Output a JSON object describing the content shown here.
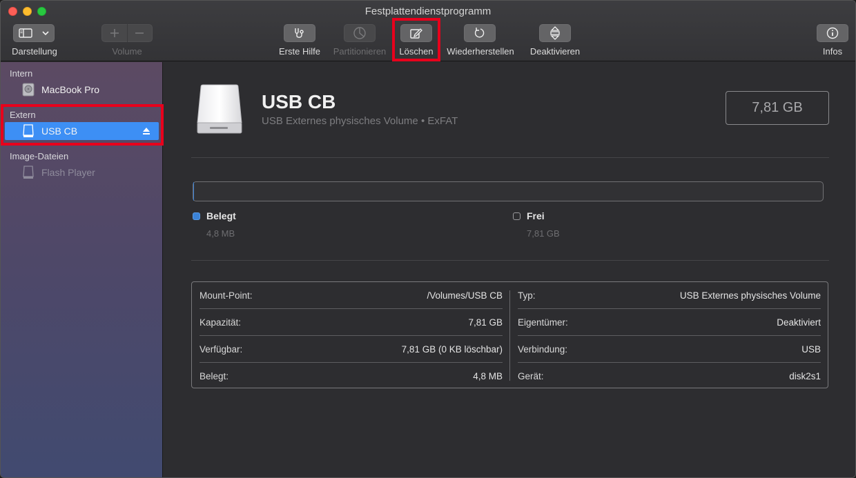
{
  "window": {
    "title": "Festplattendienstprogramm"
  },
  "toolbar": {
    "view_label": "Darstellung",
    "volume_label": "Volume",
    "firstaid_label": "Erste Hilfe",
    "partition_label": "Partitionieren",
    "erase_label": "Löschen",
    "restore_label": "Wiederherstellen",
    "unmount_label": "Deaktivieren",
    "info_label": "Infos"
  },
  "sidebar": {
    "sections": [
      {
        "title": "Intern",
        "items": [
          {
            "label": "MacBook Pro"
          }
        ]
      },
      {
        "title": "Extern",
        "items": [
          {
            "label": "USB CB"
          }
        ]
      },
      {
        "title": "Image-Dateien",
        "items": [
          {
            "label": "Flash Player"
          }
        ]
      }
    ]
  },
  "volume": {
    "name": "USB CB",
    "subtitle": "USB Externes physisches Volume • ExFAT",
    "capacity": "7,81 GB"
  },
  "usage": {
    "used_fraction": 0.0006,
    "used_label": "Belegt",
    "used_value": "4,8 MB",
    "free_label": "Frei",
    "free_value": "7,81 GB",
    "used_color": "#3b82d6"
  },
  "info": {
    "left": [
      {
        "key": "Mount-Point:",
        "value": "/Volumes/USB CB"
      },
      {
        "key": "Kapazität:",
        "value": "7,81 GB"
      },
      {
        "key": "Verfügbar:",
        "value": "7,81 GB (0 KB löschbar)"
      },
      {
        "key": "Belegt:",
        "value": "4,8 MB"
      }
    ],
    "right": [
      {
        "key": "Typ:",
        "value": "USB Externes physisches Volume"
      },
      {
        "key": "Eigentümer:",
        "value": "Deaktiviert"
      },
      {
        "key": "Verbindung:",
        "value": "USB"
      },
      {
        "key": "Gerät:",
        "value": "disk2s1"
      }
    ]
  },
  "colors": {
    "selection": "#3d8ff5",
    "highlight": "#e8001c"
  }
}
